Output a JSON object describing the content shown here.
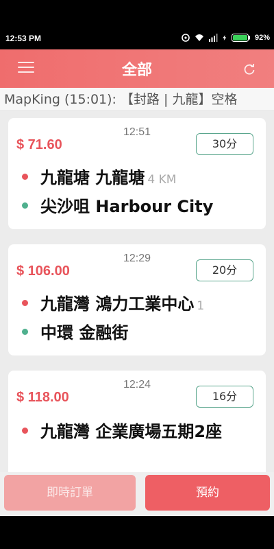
{
  "status_bar": {
    "time": "12:53 PM",
    "battery": "92%"
  },
  "header": {
    "title": "全部"
  },
  "ticker": {
    "text": "MapKing (15:01): 【封路 | 九龍】空格"
  },
  "orders": [
    {
      "price": "$ 71.60",
      "time": "12:51",
      "duration": "30分",
      "pickup": "九龍塘 九龍塘",
      "distance": "4 KM",
      "dropoff": "尖沙咀 Harbour City"
    },
    {
      "price": "$ 106.00",
      "time": "12:29",
      "duration": "20分",
      "pickup": "九龍灣 鴻力工業中心",
      "distance": "1",
      "dropoff": "中環 金融街"
    },
    {
      "price": "$ 118.00",
      "time": "12:24",
      "duration": "16分",
      "pickup": "九龍灣 企業廣場五期2座"
    }
  ],
  "bottom": {
    "instant_label": "即時訂單",
    "reserve_label": "預約"
  },
  "colors": {
    "accent": "#ee5f64",
    "price": "#e8545b",
    "green": "#4fb08e"
  }
}
